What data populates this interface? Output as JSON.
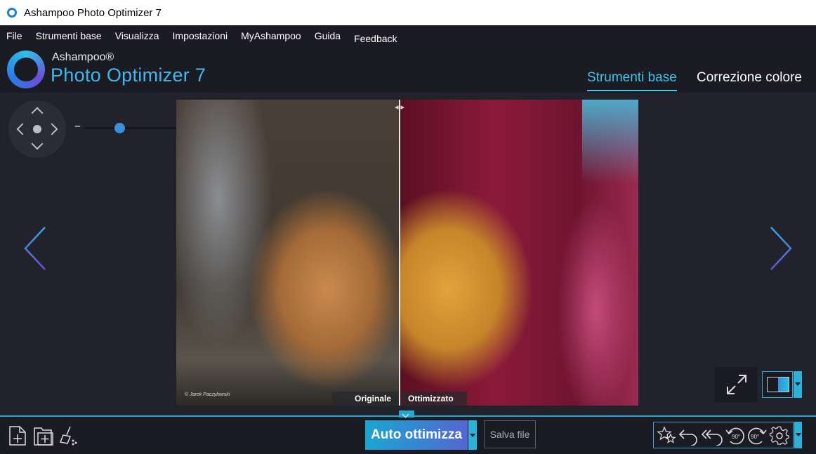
{
  "window": {
    "title": "Ashampoo Photo Optimizer 7"
  },
  "menu": {
    "items": [
      "File",
      "Strumenti base",
      "Visualizza",
      "Impostazioni",
      "MyAshampoo",
      "Guida",
      "Feedback"
    ]
  },
  "brand": {
    "name": "Ashampoo®",
    "product": "Photo Optimizer 7"
  },
  "tabs": {
    "active": "Strumenti base",
    "other": "Correzione colore"
  },
  "zoom": {
    "minus": "−",
    "plus": "+",
    "level": 0.34
  },
  "photo": {
    "label_original": "Originale",
    "label_optimized": "Ottimizzato",
    "credit": "© Jarek Paczylowski"
  },
  "toolbar": {
    "auto_optimize": "Auto ottimizza",
    "save_file": "Salva file"
  },
  "colors": {
    "accent": "#43c4ea",
    "background": "#22222c",
    "bar": "#1b1b23"
  },
  "icons": {
    "left_tools": [
      "new-file-icon",
      "new-folder-icon",
      "clean-brush-icon"
    ],
    "edit_tools": [
      "favorites-icon",
      "undo-icon",
      "undo-all-icon",
      "rotate-left-90-icon",
      "rotate-right-90-icon",
      "settings-icon"
    ]
  }
}
